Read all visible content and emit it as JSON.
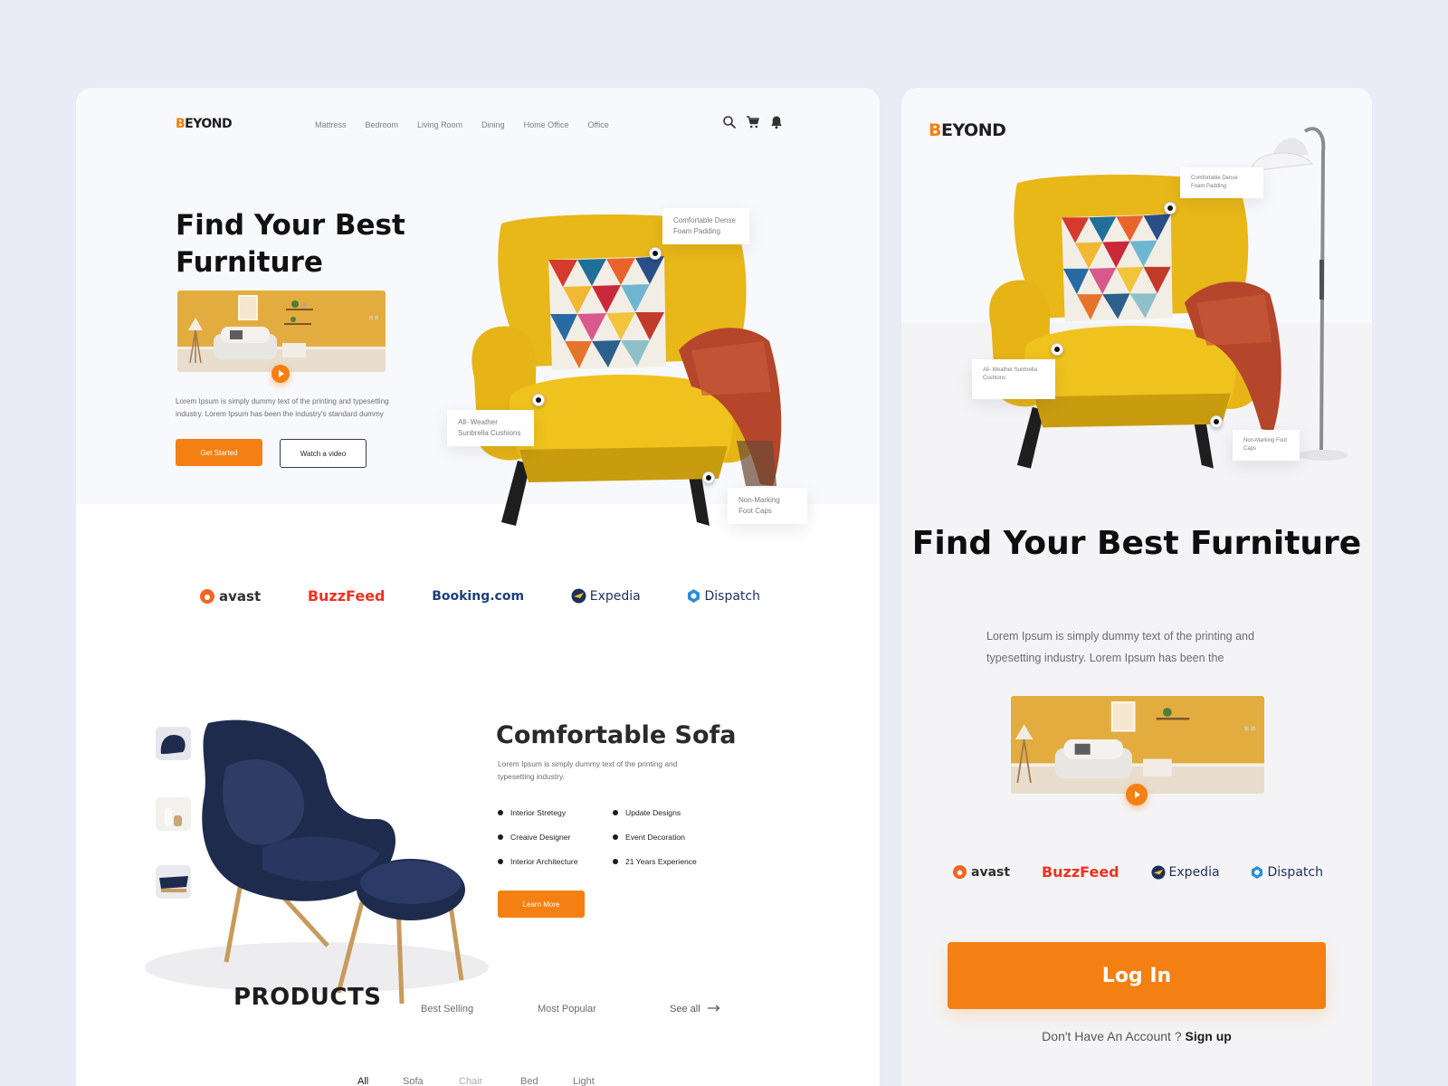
{
  "brand": {
    "first_letter": "B",
    "rest": "EYOND",
    "accent": "#f47f12"
  },
  "desktop": {
    "nav": [
      "Mattress",
      "Bedroom",
      "Living Room",
      "Dining",
      "Home Office",
      "Office"
    ],
    "hero": {
      "title": "Find Your Best Furniture",
      "lead": "Lorem Ipsum is simply dummy text of the printing and typesetting industry. Lorem Ipsum has been the industry's standard dummy",
      "primary_cta": "Get Started",
      "secondary_cta": "Watch a video"
    },
    "callouts": {
      "foam": "Comfortable Dense Foam Padding",
      "cushions": "All- Weather Sunbrella Cushions",
      "foot": "Non-Marking Foot Caps"
    },
    "brands": [
      "avast",
      "BuzzFeed",
      "Booking.com",
      "Expedia",
      "Dispatch"
    ],
    "sofa": {
      "title": "Comfortable Sofa",
      "text": "Lorem Ipsum is simply dummy text of the printing and typesetting industry.",
      "features_left": [
        "Interior Stretegy",
        "Creaive Designer",
        "Interior Architecture"
      ],
      "features_right": [
        "Update Designs",
        "Event Decoration",
        "21 Years Experience"
      ],
      "cta": "Learn More"
    },
    "products": {
      "title": "PRODUCTS",
      "tabs": [
        "Best Selling",
        "Most Popular"
      ],
      "see_all": "See all",
      "categories": [
        "All",
        "Sofa",
        "Chair",
        "Bed",
        "Light"
      ],
      "active_category": "All"
    }
  },
  "mobile": {
    "callouts": {
      "foam": "Comfortable Dense Foam Padding",
      "cushions": "All- Weather Sunbrella Cushions",
      "foot": "Non-Marking Foot Caps"
    },
    "title": "Find Your Best Furniture",
    "lead": "Lorem Ipsum is simply dummy text of the printing and typesetting industry. Lorem Ipsum has been the",
    "brands": [
      "avast",
      "BuzzFeed",
      "Expedia",
      "Dispatch"
    ],
    "login": "Log In",
    "no_account": "Don't Have An Account ?",
    "signup": "Sign up"
  },
  "icons": [
    "search-icon",
    "cart-icon",
    "bell-icon",
    "play-icon",
    "arrow-right-icon"
  ],
  "colors": {
    "orange": "#f47f12",
    "chair_yellow": "#e8b718",
    "navy_chair": "#1f2b4d",
    "background": "#e9ecf4"
  }
}
